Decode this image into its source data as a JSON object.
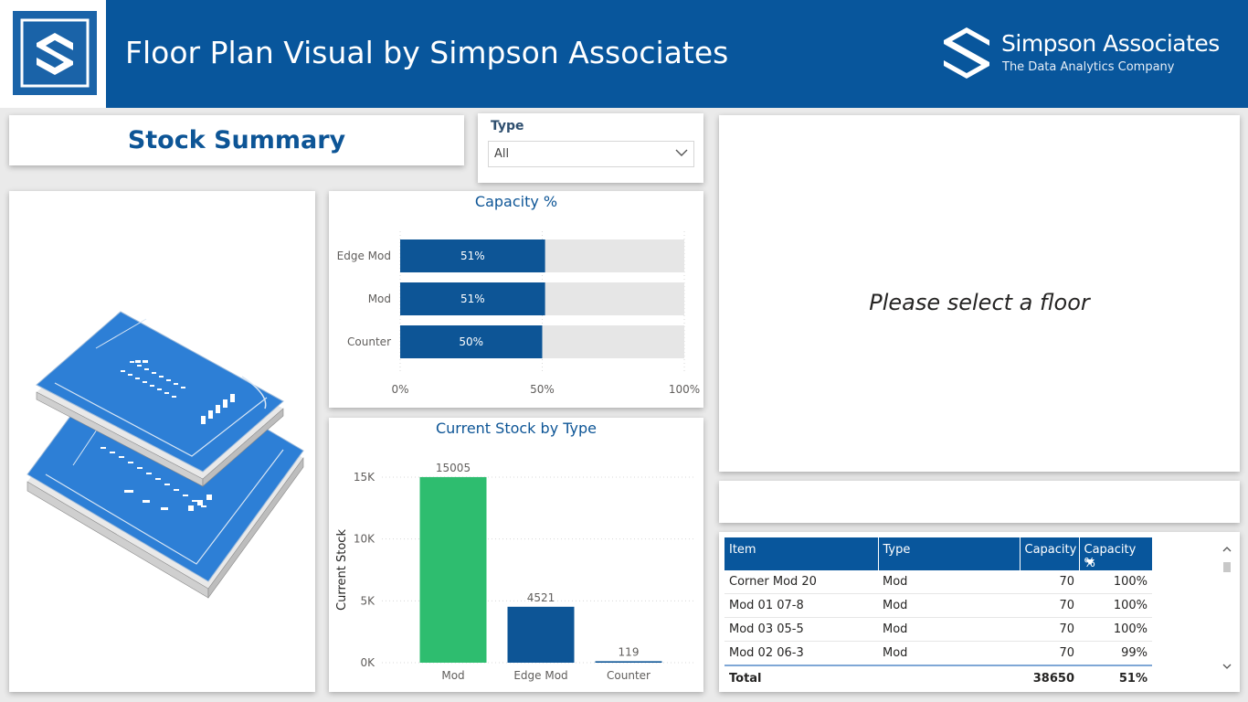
{
  "header": {
    "title": "Floor Plan Visual by Simpson Associates",
    "brand_name": "Simpson Associates",
    "brand_tagline": "The Data Analytics Company"
  },
  "summary": {
    "title": "Stock Summary"
  },
  "slicer": {
    "label": "Type",
    "value": "All"
  },
  "placeholder": {
    "text": "Please select a floor"
  },
  "colors": {
    "brand_blue": "#08569c",
    "bar_blue": "#0d5596",
    "bar_green": "#2ebd6f",
    "track_gray": "#e6e6e6"
  },
  "chart_data": [
    {
      "type": "bar",
      "orientation": "horizontal",
      "title": "Capacity %",
      "categories": [
        "Edge Mod",
        "Mod",
        "Counter"
      ],
      "values": [
        51,
        51,
        50
      ],
      "data_labels": [
        "51%",
        "51%",
        "50%"
      ],
      "xlim": [
        0,
        100
      ],
      "xticks": [
        "0%",
        "50%",
        "100%"
      ],
      "grid": true
    },
    {
      "type": "bar",
      "orientation": "vertical",
      "title": "Current Stock by Type",
      "ylabel": "Current Stock",
      "categories": [
        "Mod",
        "Edge Mod",
        "Counter"
      ],
      "values": [
        15005,
        4521,
        119
      ],
      "data_labels": [
        "15005",
        "4521",
        "119"
      ],
      "ylim": [
        0,
        15000
      ],
      "yticks": [
        "0K",
        "5K",
        "10K",
        "15K"
      ],
      "bar_colors": [
        "#2ebd6f",
        "#0d5596",
        "#0d5596"
      ],
      "grid": true
    }
  ],
  "table": {
    "columns": [
      "Item",
      "Type",
      "Capacity",
      "Capacity %"
    ],
    "rows": [
      [
        "Corner Mod 20",
        "Mod",
        "70",
        "100%"
      ],
      [
        "Mod 01 07-8",
        "Mod",
        "70",
        "100%"
      ],
      [
        "Mod 03 05-5",
        "Mod",
        "70",
        "100%"
      ],
      [
        "Mod 02 06-3",
        "Mod",
        "70",
        "99%"
      ]
    ],
    "total": [
      "Total",
      "",
      "38650",
      "51%"
    ]
  }
}
